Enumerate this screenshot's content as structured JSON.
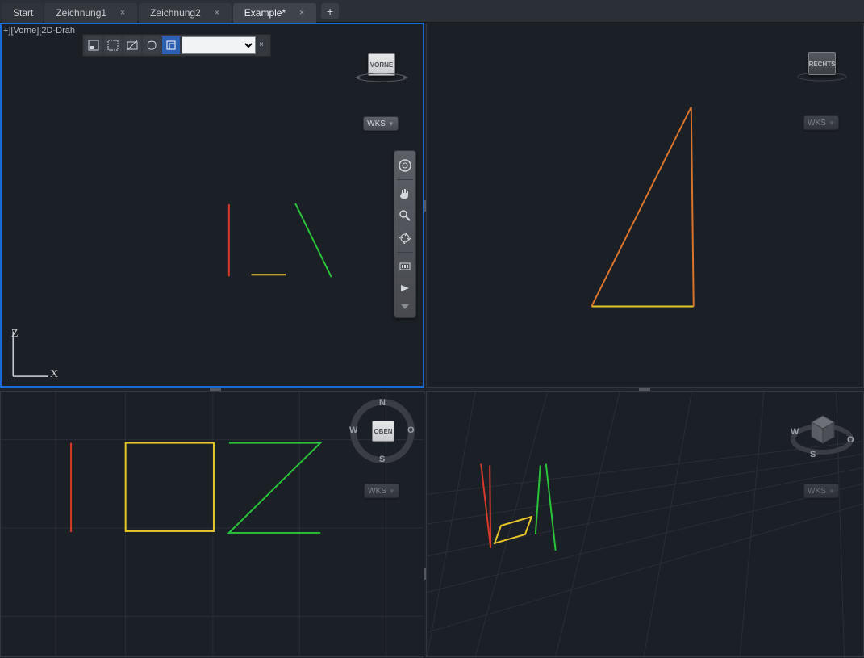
{
  "tabs": {
    "items": [
      {
        "label": "Start",
        "closable": false
      },
      {
        "label": "Zeichnung1",
        "closable": true
      },
      {
        "label": "Zeichnung2",
        "closable": true
      },
      {
        "label": "Example*",
        "closable": true
      }
    ],
    "active_index": 3,
    "add_glyph": "+"
  },
  "viewport_label": "+][Vorne][2D-Drah",
  "close_glyph": "×",
  "quickbar_close": "×",
  "wks_label": "WKS",
  "axis": {
    "x": "X",
    "z": "Z"
  },
  "viewcubes": {
    "tl": "VORNE",
    "tr": "RECHTS",
    "bl": "OBEN"
  },
  "compass_dirs": {
    "n": "N",
    "s": "S",
    "w": "W",
    "o": "O"
  },
  "nav_tools": [
    "full-nav-wheel-icon",
    "pan-icon",
    "zoom-icon",
    "orbit-icon",
    "showmotion-icon",
    "views-icon"
  ],
  "quickbar_tools": [
    "selection-set-icon",
    "select-window-icon",
    "select-crossing-icon",
    "lasso-icon",
    "select-similar-icon"
  ],
  "quickbar_select_value": "",
  "colors": {
    "red": "#d83a2b",
    "green": "#29c43a",
    "yellow": "#e6c52a",
    "orange": "#d8742b"
  }
}
